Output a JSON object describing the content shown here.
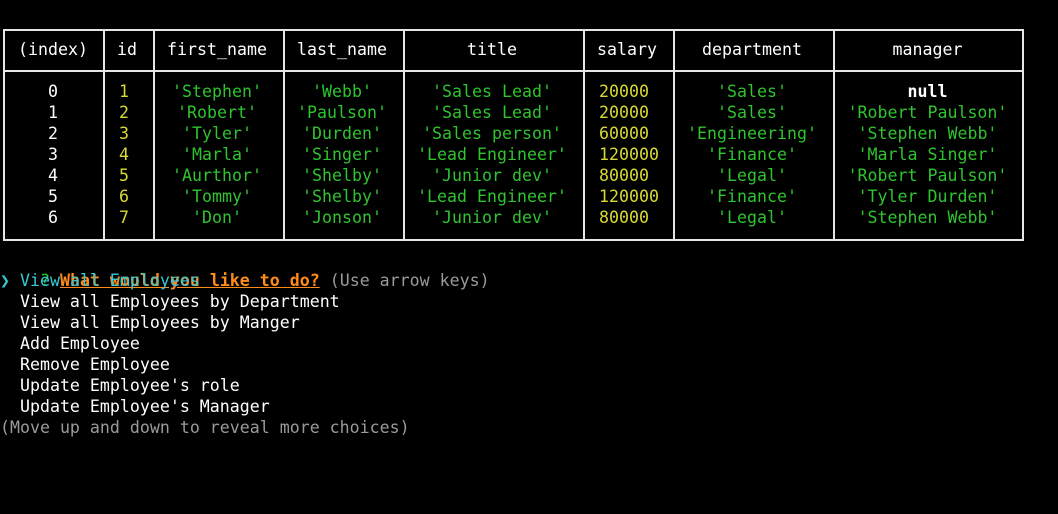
{
  "table": {
    "columns": [
      "(index)",
      "id",
      "first_name",
      "last_name",
      "title",
      "salary",
      "department",
      "manager"
    ],
    "rows": [
      [
        "0",
        "1",
        "'Stephen'",
        "'Webb'",
        "'Sales Lead'",
        "20000",
        "'Sales'",
        "null"
      ],
      [
        "1",
        "2",
        "'Robert'",
        "'Paulson'",
        "'Sales Lead'",
        "20000",
        "'Sales'",
        "'Robert Paulson'"
      ],
      [
        "2",
        "3",
        "'Tyler'",
        "'Durden'",
        "'Sales person'",
        "60000",
        "'Engineering'",
        "'Stephen Webb'"
      ],
      [
        "3",
        "4",
        "'Marla'",
        "'Singer'",
        "'Lead Engineer'",
        "120000",
        "'Finance'",
        "'Marla Singer'"
      ],
      [
        "4",
        "5",
        "'Aurthor'",
        "'Shelby'",
        "'Junior dev'",
        "80000",
        "'Legal'",
        "'Robert Paulson'"
      ],
      [
        "5",
        "6",
        "'Tommy'",
        "'Shelby'",
        "'Lead Engineer'",
        "120000",
        "'Finance'",
        "'Tyler Durden'"
      ],
      [
        "6",
        "7",
        "'Don'",
        "'Jonson'",
        "'Junior dev'",
        "80000",
        "'Legal'",
        "'Stephen Webb'"
      ]
    ]
  },
  "prompt": {
    "mark": "?",
    "question": "What would you like to do?",
    "hint": "(Use arrow keys)",
    "pointer": "❯",
    "choices": [
      "View all Employees",
      "View all Employees by Department",
      "View all Employees by Manger",
      "Add Employee",
      "Remove Employee",
      "Update Employee's role",
      "Update Employee's Manager"
    ],
    "selected_index": 0,
    "footer": "(Move up and down to reveal more choices)"
  },
  "colors": {
    "background": "#000000",
    "border": "#e6e6e6",
    "number": "#d9d934",
    "string": "#2fc32f",
    "question": "#ff8c1a",
    "selected": "#35c9d6",
    "muted": "#9a9a9a"
  }
}
